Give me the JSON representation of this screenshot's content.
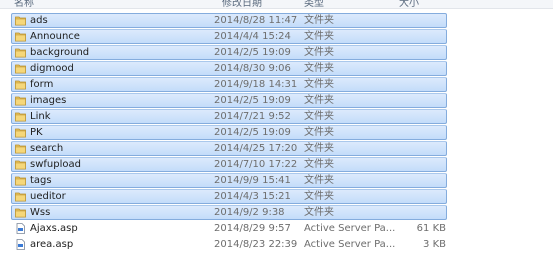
{
  "header": {
    "name": "名称",
    "date": "修改日期",
    "type": "类型",
    "size": "大小"
  },
  "items": [
    {
      "name": "ads",
      "date": "2014/8/28 11:47",
      "type": "文件夹",
      "size": "",
      "kind": "folder",
      "selected": true
    },
    {
      "name": "Announce",
      "date": "2014/4/4 15:24",
      "type": "文件夹",
      "size": "",
      "kind": "folder",
      "selected": true
    },
    {
      "name": "background",
      "date": "2014/2/5 19:09",
      "type": "文件夹",
      "size": "",
      "kind": "folder",
      "selected": true
    },
    {
      "name": "digmood",
      "date": "2014/8/30 9:06",
      "type": "文件夹",
      "size": "",
      "kind": "folder",
      "selected": true
    },
    {
      "name": "form",
      "date": "2014/9/18 14:31",
      "type": "文件夹",
      "size": "",
      "kind": "folder",
      "selected": true
    },
    {
      "name": "images",
      "date": "2014/2/5 19:09",
      "type": "文件夹",
      "size": "",
      "kind": "folder",
      "selected": true
    },
    {
      "name": "Link",
      "date": "2014/7/21 9:52",
      "type": "文件夹",
      "size": "",
      "kind": "folder",
      "selected": true
    },
    {
      "name": "PK",
      "date": "2014/2/5 19:09",
      "type": "文件夹",
      "size": "",
      "kind": "folder",
      "selected": true
    },
    {
      "name": "search",
      "date": "2014/4/25 17:20",
      "type": "文件夹",
      "size": "",
      "kind": "folder",
      "selected": true
    },
    {
      "name": "swfupload",
      "date": "2014/7/10 17:22",
      "type": "文件夹",
      "size": "",
      "kind": "folder",
      "selected": true
    },
    {
      "name": "tags",
      "date": "2014/9/9 15:41",
      "type": "文件夹",
      "size": "",
      "kind": "folder",
      "selected": true
    },
    {
      "name": "ueditor",
      "date": "2014/4/3 15:21",
      "type": "文件夹",
      "size": "",
      "kind": "folder",
      "selected": true
    },
    {
      "name": "Wss",
      "date": "2014/9/2 9:38",
      "type": "文件夹",
      "size": "",
      "kind": "folder",
      "selected": true
    },
    {
      "name": "Ajaxs.asp",
      "date": "2014/8/29 9:57",
      "type": "Active Server Pa...",
      "size": "61 KB",
      "kind": "asp",
      "selected": false
    },
    {
      "name": "area.asp",
      "date": "2014/8/23 22:39",
      "type": "Active Server Pa...",
      "size": "3 KB",
      "kind": "asp",
      "selected": false
    }
  ],
  "colors": {
    "selection_fill_top": "#dceafc",
    "selection_fill_bottom": "#c3dcfa",
    "selection_border": "#84acdd",
    "folder": "#e8c25a"
  }
}
